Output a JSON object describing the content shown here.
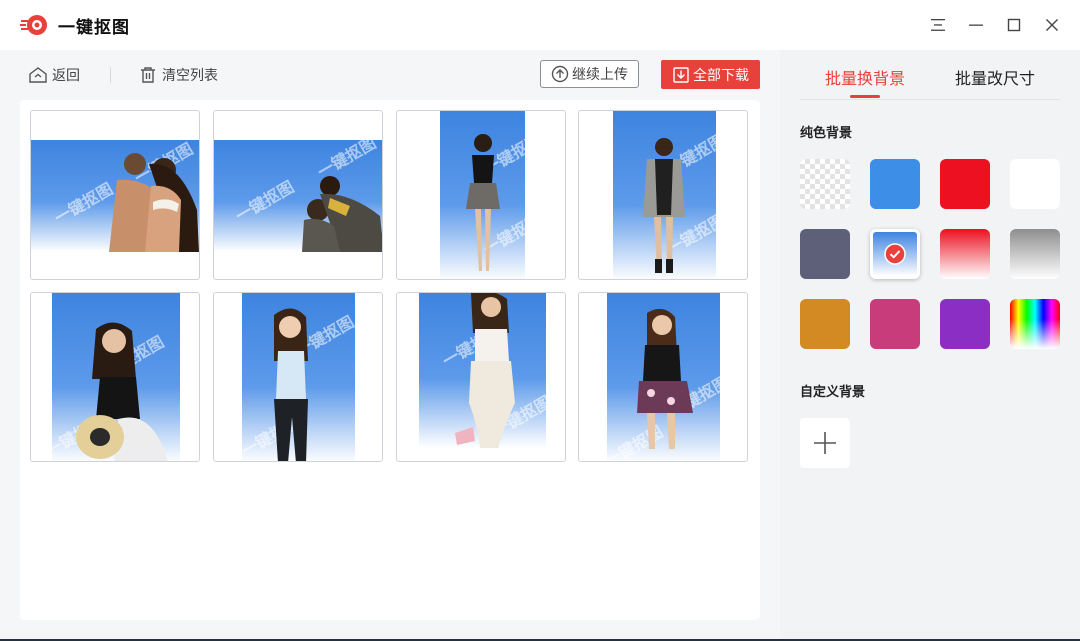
{
  "app": {
    "title": "一键抠图",
    "colors": {
      "accent": "#e8403a",
      "photo_blue": "#3d84e0"
    }
  },
  "window_controls": {
    "icons": [
      "menu-icon",
      "minimize-icon",
      "maximize-icon",
      "close-icon"
    ]
  },
  "toolbar": {
    "back_label": "返回",
    "clear_label": "清空列表",
    "upload_label": "继续上传",
    "download_label": "全部下载"
  },
  "gallery": {
    "watermark": "一键抠图",
    "items": [
      {
        "subject": "couple on blue background"
      },
      {
        "subject": "two people on blue background"
      },
      {
        "subject": "woman in plaid skirt"
      },
      {
        "subject": "woman in grey coat"
      },
      {
        "subject": "woman with straw hat"
      },
      {
        "subject": "woman in light top"
      },
      {
        "subject": "woman in white outfit"
      },
      {
        "subject": "woman in floral skirt"
      }
    ]
  },
  "sidebar": {
    "tabs": [
      {
        "label": "批量换背景",
        "active": true
      },
      {
        "label": "批量改尺寸",
        "active": false
      }
    ],
    "solid_title": "纯色背景",
    "custom_title": "自定义背景",
    "swatches": [
      {
        "name": "transparent",
        "color": "checker"
      },
      {
        "name": "blue",
        "color": "#3d8ee6"
      },
      {
        "name": "red",
        "color": "#ec1020"
      },
      {
        "name": "white",
        "color": "#ffffff"
      },
      {
        "name": "slate",
        "color": "#5e5f78"
      },
      {
        "name": "blue-white-gradient",
        "color": "#3d84e0",
        "selected": true
      },
      {
        "name": "red-gradient",
        "color": "#ec1020"
      },
      {
        "name": "grey-gradient",
        "color": "#8e8e8e"
      },
      {
        "name": "orange",
        "color": "#d38a22"
      },
      {
        "name": "pink",
        "color": "#c93c7c"
      },
      {
        "name": "purple",
        "color": "#8a2ec4"
      },
      {
        "name": "rainbow",
        "color": "spectrum"
      }
    ]
  }
}
